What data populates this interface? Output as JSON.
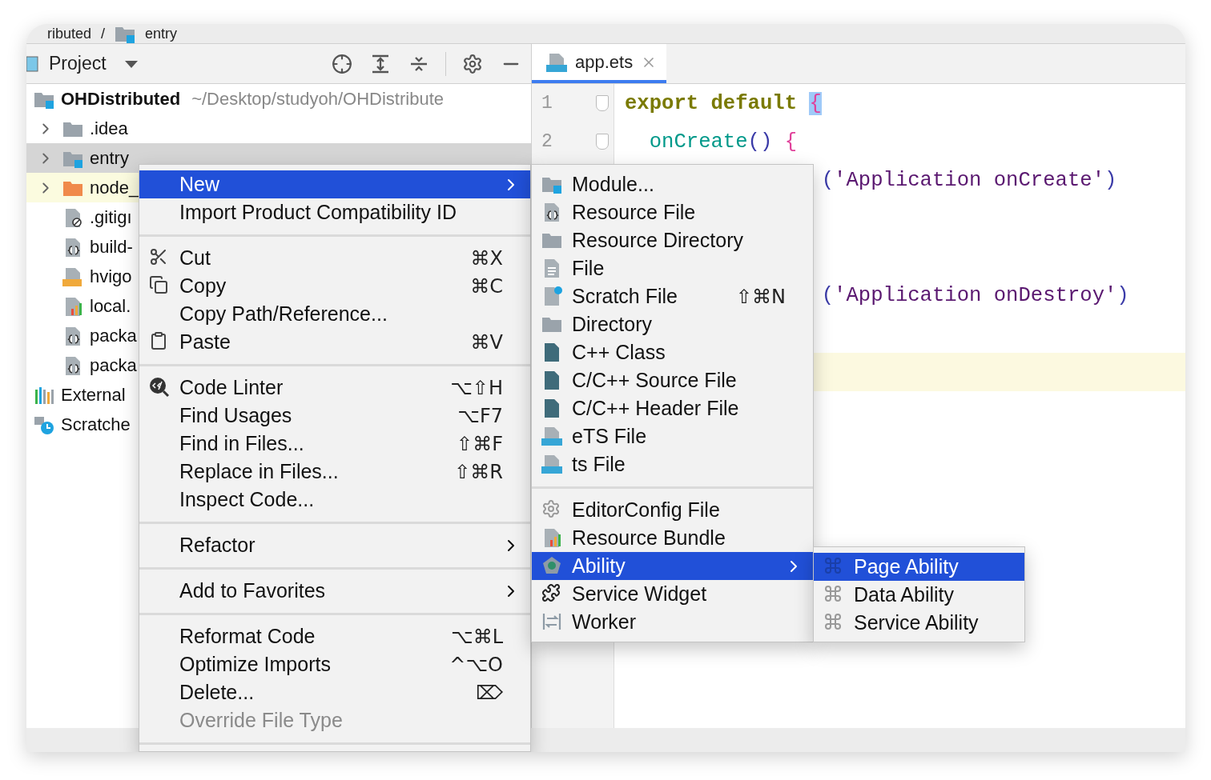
{
  "breadcrumb": {
    "items": [
      {
        "label": "ributed"
      },
      {
        "label": "entry"
      }
    ],
    "separator": "/"
  },
  "project_panel": {
    "title": "Project",
    "tree": [
      {
        "label": "OHDistributed",
        "path": "~/Desktop/studyoh/OHDistribute",
        "selected": false,
        "highlighted": false,
        "children": [
          {
            "label": ".idea",
            "expanded": false,
            "selected": false,
            "highlighted": false
          },
          {
            "label": "entry",
            "expanded": false,
            "selected": true,
            "highlighted": false
          },
          {
            "label": "node_",
            "expanded": false,
            "selected": false,
            "highlighted": true
          },
          {
            "label": ".gitigı",
            "selected": false,
            "highlighted": false
          },
          {
            "label": "build-",
            "selected": false,
            "highlighted": false
          },
          {
            "label": "hvigo",
            "selected": false,
            "highlighted": false
          },
          {
            "label": "local.",
            "selected": false,
            "highlighted": false
          },
          {
            "label": "packa",
            "selected": false,
            "highlighted": false
          },
          {
            "label": "packa",
            "selected": false,
            "highlighted": false
          }
        ]
      },
      {
        "label": "External",
        "selected": false,
        "highlighted": false
      },
      {
        "label": "Scratche",
        "selected": false,
        "highlighted": false
      }
    ]
  },
  "editor": {
    "tabs": [
      {
        "label": "app.ets",
        "selected": true
      }
    ],
    "lines": [
      {
        "number": "1",
        "current": false,
        "tokens": [
          {
            "text": "export default",
            "kind": "keyword"
          },
          {
            "text": "{",
            "kind": "brace-match"
          }
        ]
      },
      {
        "number": "2",
        "current": false,
        "tokens": [
          {
            "text": "onCreate",
            "kind": "function"
          },
          {
            "text": "()",
            "kind": "paren"
          },
          {
            "text": "{",
            "kind": "brace"
          }
        ]
      },
      {
        "current": false,
        "tokens": [
          {
            "text": "(",
            "kind": "paren"
          },
          {
            "text": "'Application onCreate'",
            "kind": "string"
          },
          {
            "text": ")",
            "kind": "paren"
          }
        ]
      },
      {
        "current": false
      },
      {
        "current": false
      },
      {
        "current": false,
        "tokens": [
          {
            "text": "(",
            "kind": "paren"
          },
          {
            "text": "'Application onDestroy'",
            "kind": "string"
          },
          {
            "text": ")",
            "kind": "paren"
          }
        ]
      },
      {
        "current": false
      },
      {
        "current": true
      }
    ]
  },
  "context_menu": {
    "groups": [
      [
        {
          "label": "New",
          "selected": true,
          "disabled": false,
          "submenu": true
        },
        {
          "label": "Import Product Compatibility ID",
          "selected": false,
          "disabled": false,
          "submenu": false
        }
      ],
      [
        {
          "label": "Cut",
          "shortcut": "⌘X",
          "selected": false,
          "disabled": false,
          "submenu": false
        },
        {
          "label": "Copy",
          "shortcut": "⌘C",
          "selected": false,
          "disabled": false,
          "submenu": false
        },
        {
          "label": "Copy Path/Reference...",
          "selected": false,
          "disabled": false,
          "submenu": false
        },
        {
          "label": "Paste",
          "shortcut": "⌘V",
          "selected": false,
          "disabled": false,
          "submenu": false
        }
      ],
      [
        {
          "label": "Code Linter",
          "shortcut": "⌥⇧H",
          "selected": false,
          "disabled": false,
          "submenu": false
        },
        {
          "label": "Find Usages",
          "shortcut": "⌥F7",
          "selected": false,
          "disabled": false,
          "submenu": false
        },
        {
          "label": "Find in Files...",
          "shortcut": "⇧⌘F",
          "selected": false,
          "disabled": false,
          "submenu": false
        },
        {
          "label": "Replace in Files...",
          "shortcut": "⇧⌘R",
          "selected": false,
          "disabled": false,
          "submenu": false
        },
        {
          "label": "Inspect Code...",
          "selected": false,
          "disabled": false,
          "submenu": false
        }
      ],
      [
        {
          "label": "Refactor",
          "selected": false,
          "disabled": false,
          "submenu": true
        }
      ],
      [
        {
          "label": "Add to Favorites",
          "selected": false,
          "disabled": false,
          "submenu": true
        }
      ],
      [
        {
          "label": "Reformat Code",
          "shortcut": "⌥⌘L",
          "selected": false,
          "disabled": false,
          "submenu": false
        },
        {
          "label": "Optimize Imports",
          "shortcut": "^⌥O",
          "selected": false,
          "disabled": false,
          "submenu": false
        },
        {
          "label": "Delete...",
          "shortcut": "⌦",
          "selected": false,
          "disabled": false,
          "submenu": false
        },
        {
          "label": "Override File Type",
          "selected": false,
          "disabled": true,
          "submenu": false
        }
      ]
    ]
  },
  "new_submenu": {
    "groups": [
      [
        {
          "label": "Module...",
          "selected": false,
          "disabled": false,
          "submenu": false
        },
        {
          "label": "Resource File",
          "selected": false,
          "disabled": false,
          "submenu": false
        },
        {
          "label": "Resource Directory",
          "selected": false,
          "disabled": false,
          "submenu": false
        },
        {
          "label": "File",
          "selected": false,
          "disabled": false,
          "submenu": false
        },
        {
          "label": "Scratch File",
          "shortcut": "⇧⌘N",
          "selected": false,
          "disabled": false,
          "submenu": false
        },
        {
          "label": "Directory",
          "selected": false,
          "disabled": false,
          "submenu": false
        },
        {
          "label": "C++ Class",
          "selected": false,
          "disabled": false,
          "submenu": false
        },
        {
          "label": "C/C++ Source File",
          "selected": false,
          "disabled": false,
          "submenu": false
        },
        {
          "label": "C/C++ Header File",
          "selected": false,
          "disabled": false,
          "submenu": false
        },
        {
          "label": "eTS File",
          "selected": false,
          "disabled": false,
          "submenu": false
        },
        {
          "label": "ts File",
          "selected": false,
          "disabled": false,
          "submenu": false
        }
      ],
      [
        {
          "label": "EditorConfig File",
          "selected": false,
          "disabled": false,
          "submenu": false
        },
        {
          "label": "Resource Bundle",
          "selected": false,
          "disabled": false,
          "submenu": false
        },
        {
          "label": "Ability",
          "selected": true,
          "disabled": false,
          "submenu": true
        },
        {
          "label": "Service Widget",
          "selected": false,
          "disabled": false,
          "submenu": false
        },
        {
          "label": "Worker",
          "selected": false,
          "disabled": false,
          "submenu": false
        }
      ]
    ]
  },
  "ability_submenu": {
    "groups": [
      [
        {
          "label": "Page Ability",
          "selected": true,
          "disabled": false,
          "submenu": false
        },
        {
          "label": "Data Ability",
          "selected": false,
          "disabled": false,
          "submenu": false
        },
        {
          "label": "Service Ability",
          "selected": false,
          "disabled": false,
          "submenu": false
        }
      ]
    ]
  }
}
